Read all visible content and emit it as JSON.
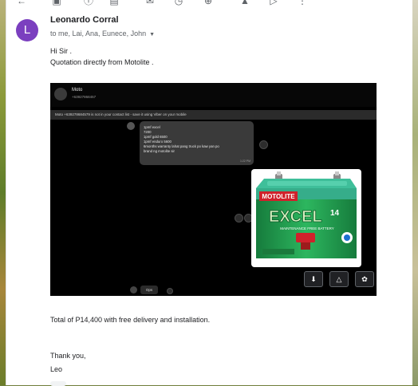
{
  "email": {
    "sender_initial": "L",
    "sender_name": "Leonardo Corral",
    "recipients": "to me, Lai, Ana, Eunece, John",
    "greeting": "Hi Sir .",
    "line1": "Quotation directly from Motolite .",
    "total_line": "Total of P14,400 with free delivery and installation.",
    "thanks": "Thank you,",
    "signoff": "Leo"
  },
  "toolbar": {
    "icons": [
      "back-icon",
      "archive-icon",
      "report-icon",
      "delete-icon",
      "mark-unread-icon",
      "snooze-icon",
      "add-task-icon",
      "move-icon",
      "label-icon",
      "more-icon"
    ]
  },
  "attachment_screenshot": {
    "contact_name": "Moto",
    "contact_number": "+63927868457",
    "banner_text": "Moto +639278684579 is not in your contact list - save it using Viber on your mobile",
    "message_lines": [
      "1pmf excel",
      "7200",
      "1pmf gold 6500",
      "1pmf enduro 5600",
      "6months warranty lahat pang truck po kaw yan po",
      "brand ng motolite sir"
    ],
    "message_time": "1:22 PM",
    "footer_chip": "Ops",
    "battery_brand": "MOTOLITE",
    "battery_model": "EXCEL",
    "battery_model_suffix": "14",
    "battery_tagline": "MAINTENANCE FREE BATTERY"
  },
  "image_actions": {
    "download": "download-icon",
    "add_to_drive": "add-to-drive-icon",
    "add_to_photos": "add-to-photos-icon"
  },
  "colors": {
    "avatar": "#7b3fbf",
    "battery_green": "#1f9c4e",
    "battery_top": "#3fbf9a",
    "brand_red": "#d0212b"
  }
}
